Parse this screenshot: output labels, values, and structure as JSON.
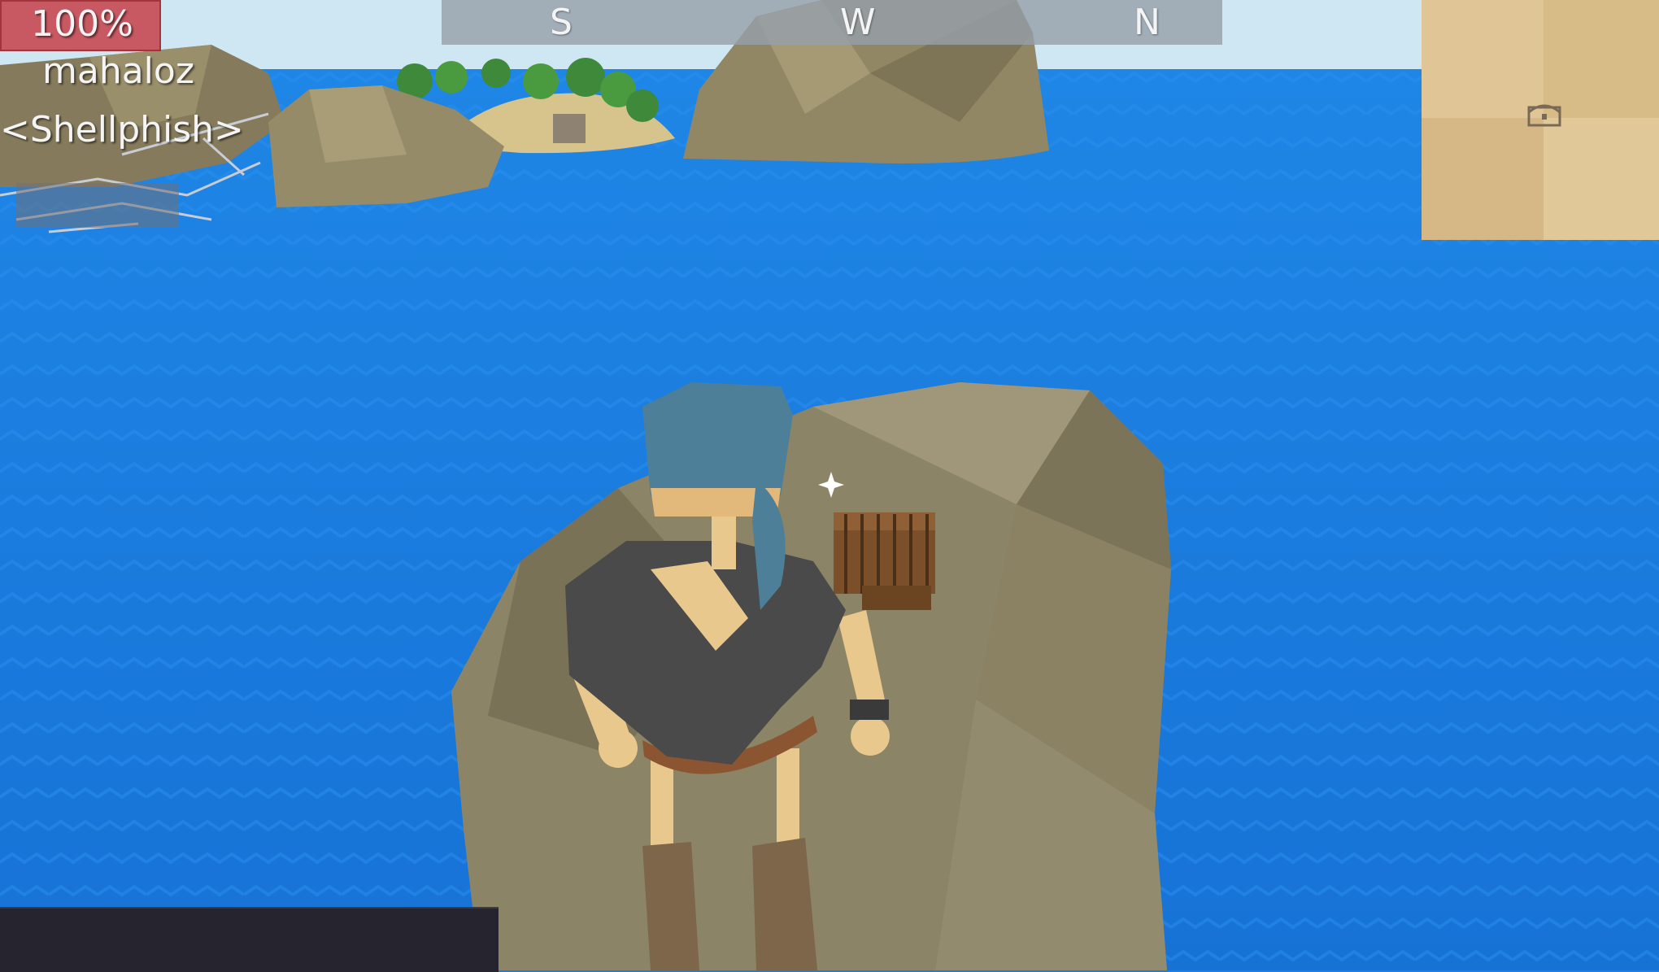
{
  "hud": {
    "health_label": "100%",
    "health_fraction": 1.0,
    "player_name": "mahaloz",
    "crew_tag": "<Shellphish>"
  },
  "compass": {
    "headings": [
      "S",
      "W",
      "N"
    ]
  },
  "minimap": {
    "marker_icon": "treasure-chest-icon"
  },
  "colors": {
    "ocean": "#1a7fe0",
    "sky": "#cfe6f3",
    "rock": "#8c8466",
    "sand": "#d9bf84",
    "health_bar": "#c4464e",
    "compass_bar": "#96a0aa",
    "chat_box": "#25242f"
  }
}
